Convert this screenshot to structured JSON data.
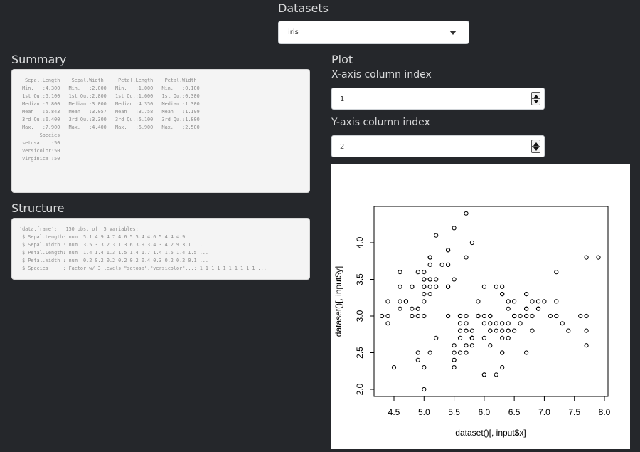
{
  "datasets": {
    "label": "Datasets",
    "selected": "iris"
  },
  "summary": {
    "title": "Summary",
    "text": "  Sepal.Length    Sepal.Width     Petal.Length    Petal.Width   \n Min.   :4.300   Min.   :2.000   Min.   :1.000   Min.   :0.100  \n 1st Qu.:5.100   1st Qu.:2.800   1st Qu.:1.600   1st Qu.:0.300  \n Median :5.800   Median :3.000   Median :4.350   Median :1.300  \n Mean   :5.843   Mean   :3.057   Mean   :3.758   Mean   :1.199  \n 3rd Qu.:6.400   3rd Qu.:3.300   3rd Qu.:5.100   3rd Qu.:1.800  \n Max.   :7.900   Max.   :4.400   Max.   :6.900   Max.   :2.500  \n       Species  \n setosa    :50  \n versicolor:50  \n virginica :50  "
  },
  "structure": {
    "title": "Structure",
    "text": "'data.frame':   150 obs. of  5 variables:\n $ Sepal.Length: num  5.1 4.9 4.7 4.6 5 5.4 4.6 5 4.4 4.9 ...\n $ Sepal.Width : num  3.5 3 3.2 3.1 3.6 3.9 3.4 3.4 2.9 3.1 ...\n $ Petal.Length: num  1.4 1.4 1.3 1.5 1.4 1.7 1.4 1.5 1.4 1.5 ...\n $ Petal.Width : num  0.2 0.2 0.2 0.2 0.2 0.4 0.3 0.2 0.2 0.1 ...\n $ Species     : Factor w/ 3 levels \"setosa\",\"versicolor\",..: 1 1 1 1 1 1 1 1 1 1 ..."
  },
  "plot": {
    "title": "Plot",
    "x_label": "X-axis column index",
    "x_value": "1",
    "y_label": "Y-axis column index",
    "y_value": "2"
  },
  "chart_data": {
    "type": "scatter",
    "xlabel": "dataset()[, input$x]",
    "ylabel": "dataset()[, input$y]",
    "xlim": [
      4.3,
      7.9
    ],
    "ylim": [
      2.0,
      4.4
    ],
    "xticks": [
      "4.5",
      "5.0",
      "5.5",
      "6.0",
      "6.5",
      "7.0",
      "7.5",
      "8.0"
    ],
    "yticks": [
      "2.0",
      "2.5",
      "3.0",
      "3.5",
      "4.0"
    ],
    "grid": false,
    "points": [
      [
        5.1,
        3.5
      ],
      [
        4.9,
        3.0
      ],
      [
        4.7,
        3.2
      ],
      [
        4.6,
        3.1
      ],
      [
        5.0,
        3.6
      ],
      [
        5.4,
        3.9
      ],
      [
        4.6,
        3.4
      ],
      [
        5.0,
        3.4
      ],
      [
        4.4,
        2.9
      ],
      [
        4.9,
        3.1
      ],
      [
        5.4,
        3.7
      ],
      [
        4.8,
        3.4
      ],
      [
        4.8,
        3.0
      ],
      [
        4.3,
        3.0
      ],
      [
        5.8,
        4.0
      ],
      [
        5.7,
        4.4
      ],
      [
        5.4,
        3.9
      ],
      [
        5.1,
        3.5
      ],
      [
        5.7,
        3.8
      ],
      [
        5.1,
        3.8
      ],
      [
        5.4,
        3.4
      ],
      [
        5.1,
        3.7
      ],
      [
        4.6,
        3.6
      ],
      [
        5.1,
        3.3
      ],
      [
        4.8,
        3.4
      ],
      [
        5.0,
        3.0
      ],
      [
        5.0,
        3.4
      ],
      [
        5.2,
        3.5
      ],
      [
        5.2,
        3.4
      ],
      [
        4.7,
        3.2
      ],
      [
        4.8,
        3.1
      ],
      [
        5.4,
        3.4
      ],
      [
        5.2,
        4.1
      ],
      [
        5.5,
        4.2
      ],
      [
        4.9,
        3.1
      ],
      [
        5.0,
        3.2
      ],
      [
        5.5,
        3.5
      ],
      [
        4.9,
        3.6
      ],
      [
        4.4,
        3.0
      ],
      [
        5.1,
        3.4
      ],
      [
        5.0,
        3.5
      ],
      [
        4.5,
        2.3
      ],
      [
        4.4,
        3.2
      ],
      [
        5.0,
        3.5
      ],
      [
        5.1,
        3.8
      ],
      [
        4.8,
        3.0
      ],
      [
        5.1,
        3.8
      ],
      [
        4.6,
        3.2
      ],
      [
        5.3,
        3.7
      ],
      [
        5.0,
        3.3
      ],
      [
        7.0,
        3.2
      ],
      [
        6.4,
        3.2
      ],
      [
        6.9,
        3.1
      ],
      [
        5.5,
        2.3
      ],
      [
        6.5,
        2.8
      ],
      [
        5.7,
        2.8
      ],
      [
        6.3,
        3.3
      ],
      [
        4.9,
        2.4
      ],
      [
        6.6,
        2.9
      ],
      [
        5.2,
        2.7
      ],
      [
        5.0,
        2.0
      ],
      [
        5.9,
        3.0
      ],
      [
        6.0,
        2.2
      ],
      [
        6.1,
        2.9
      ],
      [
        5.6,
        2.9
      ],
      [
        6.7,
        3.1
      ],
      [
        5.6,
        3.0
      ],
      [
        5.8,
        2.7
      ],
      [
        6.2,
        2.2
      ],
      [
        5.6,
        2.5
      ],
      [
        5.9,
        3.2
      ],
      [
        6.1,
        2.8
      ],
      [
        6.3,
        2.5
      ],
      [
        6.1,
        2.8
      ],
      [
        6.4,
        2.9
      ],
      [
        6.6,
        3.0
      ],
      [
        6.8,
        2.8
      ],
      [
        6.7,
        3.0
      ],
      [
        6.0,
        2.9
      ],
      [
        5.7,
        2.6
      ],
      [
        5.5,
        2.4
      ],
      [
        5.5,
        2.4
      ],
      [
        5.8,
        2.7
      ],
      [
        6.0,
        2.7
      ],
      [
        5.4,
        3.0
      ],
      [
        6.0,
        3.4
      ],
      [
        6.7,
        3.1
      ],
      [
        6.3,
        2.3
      ],
      [
        5.6,
        3.0
      ],
      [
        5.5,
        2.5
      ],
      [
        5.5,
        2.6
      ],
      [
        6.1,
        3.0
      ],
      [
        5.8,
        2.6
      ],
      [
        5.0,
        2.3
      ],
      [
        5.6,
        2.7
      ],
      [
        5.7,
        3.0
      ],
      [
        5.7,
        2.9
      ],
      [
        6.2,
        2.9
      ],
      [
        5.1,
        2.5
      ],
      [
        5.7,
        2.8
      ],
      [
        6.3,
        3.3
      ],
      [
        5.8,
        2.7
      ],
      [
        7.1,
        3.0
      ],
      [
        6.3,
        2.9
      ],
      [
        6.5,
        3.0
      ],
      [
        7.6,
        3.0
      ],
      [
        4.9,
        2.5
      ],
      [
        7.3,
        2.9
      ],
      [
        6.7,
        2.5
      ],
      [
        7.2,
        3.6
      ],
      [
        6.5,
        3.2
      ],
      [
        6.4,
        2.7
      ],
      [
        6.8,
        3.0
      ],
      [
        5.7,
        2.5
      ],
      [
        5.8,
        2.8
      ],
      [
        6.4,
        3.2
      ],
      [
        6.5,
        3.0
      ],
      [
        7.7,
        3.8
      ],
      [
        7.7,
        2.6
      ],
      [
        6.0,
        2.2
      ],
      [
        6.9,
        3.2
      ],
      [
        5.6,
        2.8
      ],
      [
        7.7,
        2.8
      ],
      [
        6.3,
        2.7
      ],
      [
        6.7,
        3.3
      ],
      [
        7.2,
        3.2
      ],
      [
        6.2,
        2.8
      ],
      [
        6.1,
        3.0
      ],
      [
        6.4,
        2.8
      ],
      [
        7.2,
        3.0
      ],
      [
        7.4,
        2.8
      ],
      [
        7.9,
        3.8
      ],
      [
        6.4,
        2.8
      ],
      [
        6.3,
        2.8
      ],
      [
        6.1,
        2.6
      ],
      [
        7.7,
        3.0
      ],
      [
        6.3,
        3.4
      ],
      [
        6.4,
        3.1
      ],
      [
        6.0,
        3.0
      ],
      [
        6.9,
        3.1
      ],
      [
        6.7,
        3.1
      ],
      [
        6.9,
        3.1
      ],
      [
        5.8,
        2.7
      ],
      [
        6.8,
        3.2
      ],
      [
        6.7,
        3.3
      ],
      [
        6.7,
        3.0
      ],
      [
        6.3,
        2.5
      ],
      [
        6.5,
        3.0
      ],
      [
        6.2,
        3.4
      ],
      [
        5.9,
        3.0
      ]
    ]
  }
}
